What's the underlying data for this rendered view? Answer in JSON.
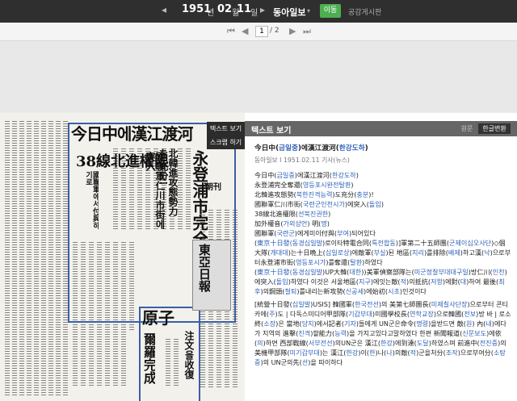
{
  "topbar": {
    "prev": "◂",
    "year": "1951",
    "year_unit": "년",
    "month": "02",
    "month_unit": "월",
    "day": "11",
    "day_unit": "일",
    "next": "▸",
    "newspaper": "동아일보",
    "newspaper_caret": "▾",
    "move_button": "이동",
    "share": "공감게시판"
  },
  "pager": {
    "first": "⏮",
    "prev": "◀",
    "current": "1",
    "total": "/ 2",
    "next": "▶",
    "last": "⏭"
  },
  "viewer_tabs": {
    "text_view": "텍스트 보기",
    "scrap": "스크랩 하기"
  },
  "newspaper_image": {
    "headline_main": "今日中에漢江渡河",
    "headline_2": "永登浦市完全奪還",
    "headline_3": "38線北進權限",
    "headline_4": "國聯軍에서付與하기로",
    "headline_5": "北韓進攻態勢力 を 充分!",
    "headline_6": "國聯軍仁川市街에突入",
    "headline_7": "原子",
    "headline_8": "爾羅完成",
    "headline_9": "注文을收復",
    "masthead_text": "東亞日報",
    "edition": "朝刊"
  },
  "reader": {
    "title": "텍스트 보기",
    "original_button": "원문",
    "convert_button": "한글변환",
    "article_title": "今日中(금일중)에漢江渡河(한강도하)",
    "meta": "동아일보  I 1951.02.11 기사(뉴스)",
    "lines": [
      "今日中(금일중)에漢江渡河(한강도하)",
      "永登浦完全奪還(영등포시완전탈환)",
      "北韓進攻態勢(북한진격능력)도充分(충분)!",
      "國聯軍仁川市街(국련군인천시가)에突入(돌입)",
      "38線北進權限(선북진권한)",
      "加外權音(가외상언) 明(명)",
      "國聯軍(국련군)에게미이付與(부여)되어있다"
    ],
    "paragraph_1": "(東京十日發(동경십일발)로이타特電合同(특전합동)]軍第二十五師團(군제이십오사단)◇個大隊(개대대)는十日晩上(십일로상)에敵軍(부실)된 地區(지리)를排除(배제)하고漢(낙)으로부터永登浦市街(영등포시가)를奪還(탈환)하였다",
    "paragraph_2": "(東京十日發(동경십일발)UP大韓(대한))美軍偵察部隊는(미군정찰부대대구일)방仁川(인천)에突入(돌입)하였다 이것은 서울地區(지구)에잇는敵(적)의抵抗(저항)에對(대)하여 最後(최후)의鋼頭(철퇴)를내리는新攻勢(신공세)에始初(시초)인것이다",
    "paragraph_3": "[統營十日發(십일발)USIS] 韓國軍(한국전선)의 美第七師團長(미제칠사단장)으로부터 콘티카에(주)도 | 다독스미디어甲部隊(기갑부대)미國學校長(연학교장)으로韓國(전보)방 바 | 로소終(소장)은 當地(당지)에서記者(기자)들에게 UN군은命令(명령)을받드면 敵(원) 內(내)에다가 지역의 進擊(진격)할能力(능력)을 가지고있다고말하였다 한편 新聞報道(신문보도)에依(의)하면 西部戰線(서부전선)의UN군은 漢江(한강)에到達(도달)하였스며 前進中(전진중)의美機甲部隊(미기갑부대)는 漢江(한강)이(한)나(나)의敵(적)군을처分(조작)으로부여分(소탕중)의 UN군의先(선)을 따이하다"
  }
}
